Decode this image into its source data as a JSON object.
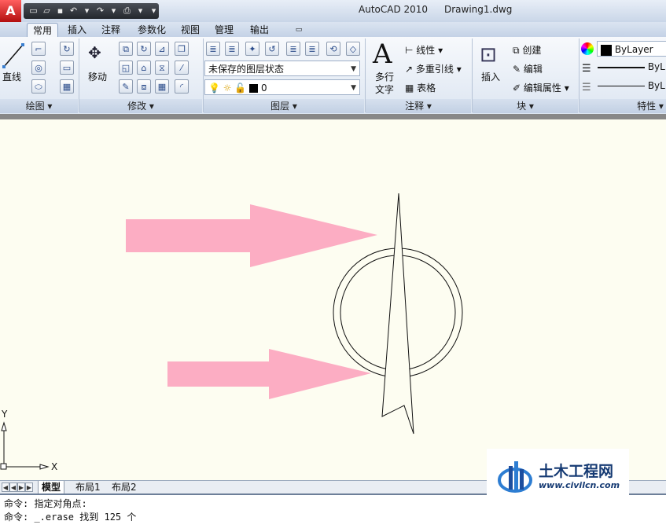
{
  "app": {
    "app_button": "A",
    "title": "AutoCAD 2010",
    "document": "Drawing1.dwg"
  },
  "quick_access": [
    "new-icon",
    "open-icon",
    "save-icon",
    "undo-icon",
    "redo-icon",
    "plot-icon"
  ],
  "tabs": [
    {
      "label": "常用",
      "active": true
    },
    {
      "label": "插入"
    },
    {
      "label": "注释"
    },
    {
      "label": "参数化"
    },
    {
      "label": "视图"
    },
    {
      "label": "管理"
    },
    {
      "label": "输出"
    }
  ],
  "ribbon": {
    "draw": {
      "label": "绘图",
      "line_label": "直线"
    },
    "modify": {
      "label": "修改",
      "move_label": "移动"
    },
    "layers": {
      "label": "图层",
      "state_combo": "未保存的图层状态",
      "layer_combo": "0"
    },
    "annotation": {
      "label": "注释",
      "mtext_label_1": "多行",
      "mtext_label_2": "文字",
      "linear": "线性",
      "mleader": "多重引线",
      "table": "表格"
    },
    "block": {
      "label": "块",
      "insert": "插入",
      "create": "创建",
      "edit": "编辑",
      "edit_attr": "编辑属性"
    },
    "properties": {
      "label": "特性",
      "color": "ByLayer",
      "linetype": "ByL",
      "lineweight": "ByL"
    }
  },
  "canvas": {
    "ucs_y": "Y",
    "ucs_x": "X",
    "colors": {
      "arrow": "#fcadc3",
      "background": "#fdfdf1",
      "stroke": "#111111"
    }
  },
  "layout_tabs": [
    "模型",
    "布局1",
    "布局2"
  ],
  "command_line": [
    "命令: 指定对角点:",
    "命令: _.erase 找到 125 个"
  ],
  "watermark": {
    "name": "土木工程网",
    "url": "www.civilcn.com"
  }
}
